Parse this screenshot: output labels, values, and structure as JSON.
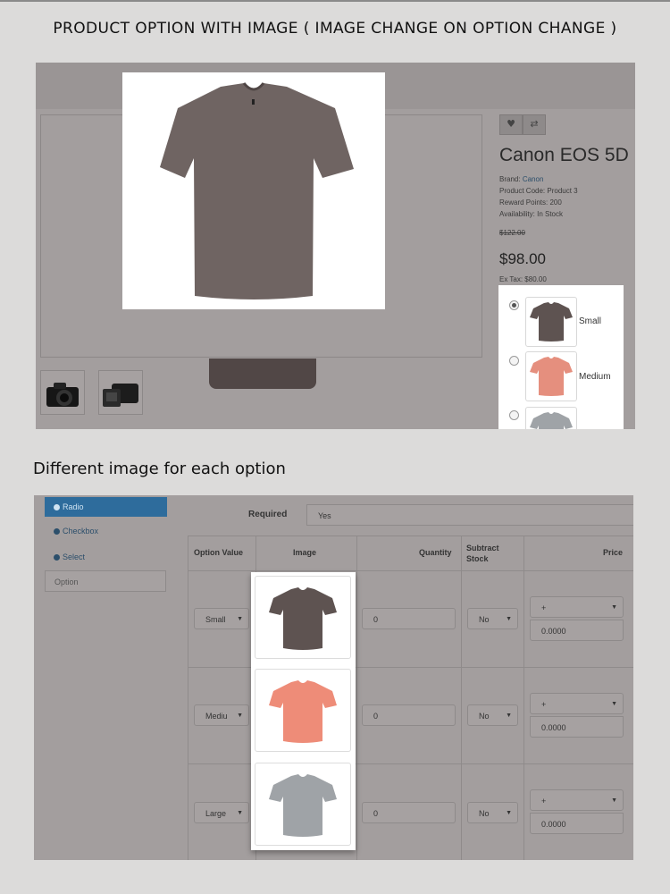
{
  "headings": {
    "top": "PRODUCT OPTION WITH IMAGE ( IMAGE CHANGE ON OPTION CHANGE )",
    "middle": "Different image for each option"
  },
  "product": {
    "title": "Canon EOS 5D",
    "brand_label": "Brand:",
    "brand_value": "Canon",
    "code": "Product Code: Product 3",
    "reward": "Reward Points: 200",
    "availability": "Availability: In Stock",
    "old_price": "$122.00",
    "price": "$98.00",
    "ex_tax": "Ex Tax: $80.00",
    "options": [
      {
        "label": "Small",
        "selected": true,
        "color": "#5e5351"
      },
      {
        "label": "Medium",
        "selected": false,
        "color": "#e58f7e"
      },
      {
        "label": "",
        "selected": false,
        "color": "#9fa3a7"
      }
    ]
  },
  "admin": {
    "tabs": {
      "radio": "Radio",
      "checkbox": "Checkbox",
      "select": "Select"
    },
    "option_placeholder": "Option",
    "required_label": "Required",
    "required_value": "Yes",
    "headers": {
      "option_value": "Option Value",
      "image": "Image",
      "quantity": "Quantity",
      "subtract_l1": "Subtract",
      "subtract_l2": "Stock",
      "price": "Price"
    },
    "rows": [
      {
        "value": "Small",
        "qty": "0",
        "subtract": "No",
        "prefix": "+",
        "price": "0.0000",
        "color": "#5e5351"
      },
      {
        "value": "Mediu",
        "qty": "0",
        "subtract": "No",
        "prefix": "+",
        "price": "0.0000",
        "color": "#ee8c78"
      },
      {
        "value": "Large",
        "qty": "0",
        "subtract": "No",
        "prefix": "+",
        "price": "0.0000",
        "color": "#9fa3a7"
      }
    ]
  },
  "colors": {
    "shirt_brown": "#6f6462",
    "shirt_salmon": "#ee8c78",
    "shirt_grey": "#9fa3a7",
    "overlay": "#a39e9e",
    "accent_blue": "#2e6c9c"
  },
  "icons": [
    "heart-icon",
    "compare-icon",
    "camera-icon",
    "tshirt-icon",
    "dropdown-caret-icon"
  ]
}
